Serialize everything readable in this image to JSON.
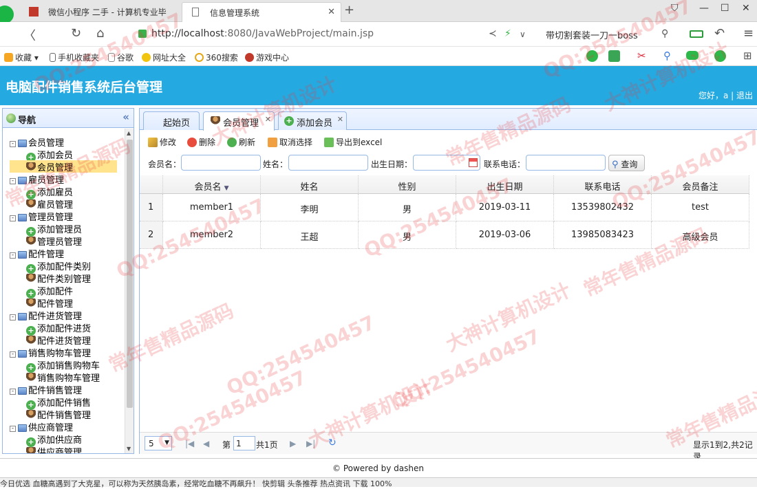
{
  "browser": {
    "tabs": [
      {
        "label": "微信小程序 二手 - 计算机专业毕",
        "active": false
      },
      {
        "label": "信息管理系统",
        "active": true
      }
    ],
    "url_host": "http://localhost",
    "url_rest": ":8080/JavaWebProject/main.jsp",
    "promo_text": "带切割套装一刀一boss",
    "bookmarks": [
      "收藏",
      "手机收藏夹",
      "谷歌",
      "网址大全",
      "360搜索",
      "游戏中心"
    ]
  },
  "app": {
    "title": "电脑配件销售系统后台管理",
    "greeting": "您好，a",
    "logout": "退出"
  },
  "nav": {
    "title": "导航",
    "groups": [
      {
        "label": "会员管理",
        "children": [
          {
            "label": "添加会员",
            "type": "add"
          },
          {
            "label": "会员管理",
            "type": "manage",
            "selected": true
          }
        ]
      },
      {
        "label": "雇员管理",
        "children": [
          {
            "label": "添加雇员",
            "type": "add"
          },
          {
            "label": "雇员管理",
            "type": "manage"
          }
        ]
      },
      {
        "label": "管理员管理",
        "children": [
          {
            "label": "添加管理员",
            "type": "add"
          },
          {
            "label": "管理员管理",
            "type": "manage"
          }
        ]
      },
      {
        "label": "配件管理",
        "children": [
          {
            "label": "添加配件类别",
            "type": "add"
          },
          {
            "label": "配件类别管理",
            "type": "manage"
          },
          {
            "label": "添加配件",
            "type": "add"
          },
          {
            "label": "配件管理",
            "type": "manage"
          }
        ]
      },
      {
        "label": "配件进货管理",
        "children": [
          {
            "label": "添加配件进货",
            "type": "add"
          },
          {
            "label": "配件进货管理",
            "type": "manage"
          }
        ]
      },
      {
        "label": "销售购物车管理",
        "children": [
          {
            "label": "添加销售购物车",
            "type": "add"
          },
          {
            "label": "销售购物车管理",
            "type": "manage"
          }
        ]
      },
      {
        "label": "配件销售管理",
        "children": [
          {
            "label": "添加配件销售",
            "type": "add"
          },
          {
            "label": "配件销售管理",
            "type": "manage"
          }
        ]
      },
      {
        "label": "供应商管理",
        "children": [
          {
            "label": "添加供应商",
            "type": "add"
          },
          {
            "label": "供应商管理",
            "type": "manage"
          }
        ]
      }
    ]
  },
  "tabs": [
    {
      "label": "起始页",
      "closable": false,
      "active": false
    },
    {
      "label": "会员管理",
      "closable": true,
      "active": true
    },
    {
      "label": "添加会员",
      "closable": true,
      "active": false
    }
  ],
  "toolbar": {
    "edit": "修改",
    "delete": "删除",
    "refresh": "刷新",
    "unselect": "取消选择",
    "export": "导出到excel"
  },
  "search": {
    "member_name_label": "会员名：",
    "name_label": "姓名：",
    "birth_label": "出生日期：",
    "phone_label": "联系电话：",
    "query_button": "查询"
  },
  "grid": {
    "columns": [
      "会员名",
      "姓名",
      "性别",
      "出生日期",
      "联系电话",
      "会员备注"
    ],
    "rows": [
      {
        "num": "1",
        "cells": [
          "member1",
          "李明",
          "男",
          "2019-03-11",
          "13539802432",
          "test"
        ]
      },
      {
        "num": "2",
        "cells": [
          "member2",
          "王超",
          "男",
          "2019-03-06",
          "13985083423",
          "高级会员"
        ]
      }
    ]
  },
  "pager": {
    "page_size": "5",
    "page_prefix": "第",
    "page_value": "1",
    "total_pages": "共1页",
    "summary": "显示1到2,共2记录"
  },
  "footer": {
    "text": "© Powered by dashen"
  },
  "status": {
    "text": "今日优选    血糖高遇到了大克星，可以称为天然胰岛素，经常吃血糖不再飙升！          快剪辑    头条推荐    热点资讯              下载            100%"
  },
  "watermarks": [
    "QQ:254540457",
    "常年售精品源码",
    "大神计算机设计"
  ],
  "colors": {
    "header": "#24a9e1",
    "panel_border": "#95b8e7",
    "selected": "#ffe48d"
  }
}
